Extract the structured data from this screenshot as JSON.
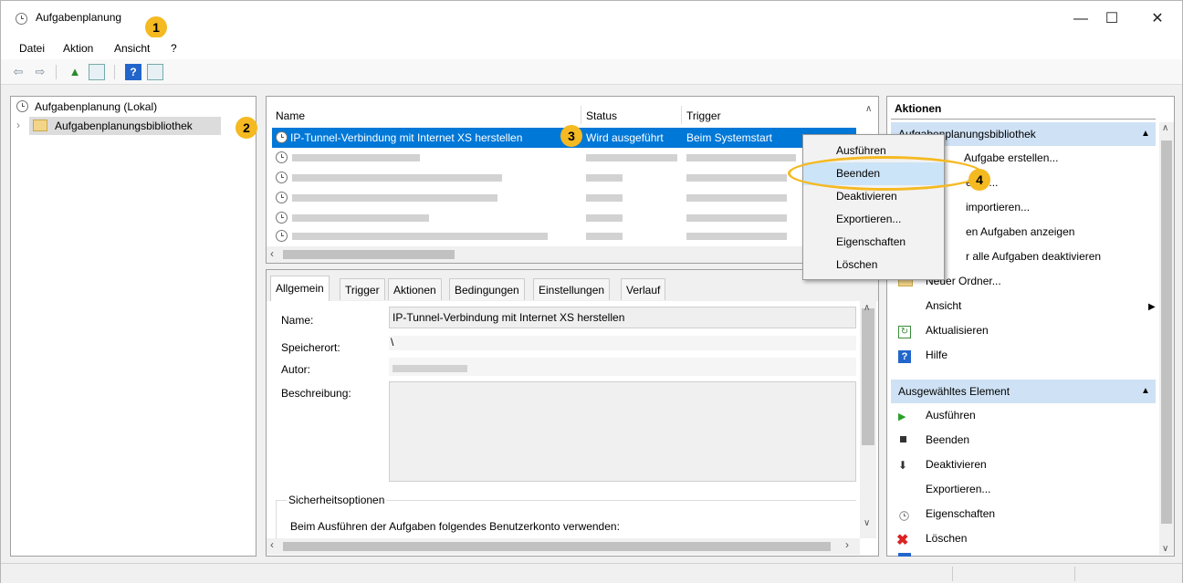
{
  "window": {
    "title": "Aufgabenplanung",
    "controls": {
      "minimize": "—",
      "maximize": "☐",
      "close": "✕"
    }
  },
  "menu": [
    "Datei",
    "Aktion",
    "Ansicht",
    "?"
  ],
  "callouts": [
    "1",
    "2",
    "3",
    "4"
  ],
  "tree": {
    "root": "Aufgabenplanung (Lokal)",
    "library": "Aufgabenplanungsbibliothek"
  },
  "tasks": {
    "columns": [
      "Name",
      "Status",
      "Trigger"
    ],
    "selected": {
      "name": "IP-Tunnel-Verbindung mit Internet XS herstellen",
      "status": "Wird ausgeführt",
      "trigger": "Beim Systemstart"
    }
  },
  "context_menu": [
    "Ausführen",
    "Beenden",
    "Deaktivieren",
    "Exportieren...",
    "Eigenschaften",
    "Löschen"
  ],
  "detail": {
    "tabs": [
      "Allgemein",
      "Trigger",
      "Aktionen",
      "Bedingungen",
      "Einstellungen",
      "Verlauf"
    ],
    "name_label": "Name:",
    "name_value": "IP-Tunnel-Verbindung mit Internet XS herstellen",
    "location_label": "Speicherort:",
    "location_value": "\\",
    "author_label": "Autor:",
    "description_label": "Beschreibung:",
    "security_title": "Sicherheitsoptionen",
    "security_text": "Beim Ausführen der Aufgaben folgendes Benutzerkonto verwenden:"
  },
  "actions": {
    "title": "Aktionen",
    "section1": "Aufgabenplanungsbibliothek",
    "items1": [
      "Aufgabe erstellen...",
      "ellen...",
      "importieren...",
      "en Aufgaben anzeigen",
      "r alle Aufgaben deaktivieren",
      "Neuer Ordner...",
      "Ansicht",
      "Aktualisieren",
      "Hilfe"
    ],
    "section2": "Ausgewähltes Element",
    "items2": [
      "Ausführen",
      "Beenden",
      "Deaktivieren",
      "Exportieren...",
      "Eigenschaften",
      "Löschen",
      "Hilfe"
    ]
  },
  "colors": {
    "selection": "#0078d7",
    "callout": "#f5b921",
    "section": "#cfe2f5"
  }
}
